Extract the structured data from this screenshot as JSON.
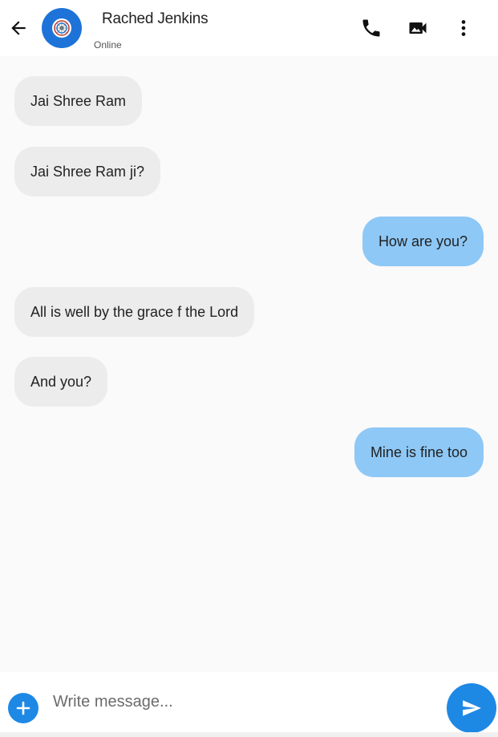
{
  "header": {
    "contact_name": "Rached Jenkins",
    "status": "Online",
    "icons": {
      "back": "arrow-back-icon",
      "avatar": "avatar-logo-icon",
      "call": "phone-icon",
      "video": "video-camera-icon",
      "more": "more-vertical-icon"
    }
  },
  "messages": [
    {
      "direction": "incoming",
      "text": "Jai Shree Ram"
    },
    {
      "direction": "incoming",
      "text": "Jai Shree Ram ji?"
    },
    {
      "direction": "outgoing",
      "text": "How are you?"
    },
    {
      "direction": "incoming",
      "text": "All is well by the grace f the Lord"
    },
    {
      "direction": "incoming",
      "text": "And you?"
    },
    {
      "direction": "outgoing",
      "text": "Mine is fine too"
    }
  ],
  "composer": {
    "placeholder": "Write message...",
    "value": "",
    "icons": {
      "add": "plus-icon",
      "send": "send-icon"
    }
  },
  "colors": {
    "accent": "#1e88e5",
    "outgoing_bubble": "#8ec8f6",
    "incoming_bubble": "#ececec",
    "avatar_bg": "#1e73d8"
  }
}
